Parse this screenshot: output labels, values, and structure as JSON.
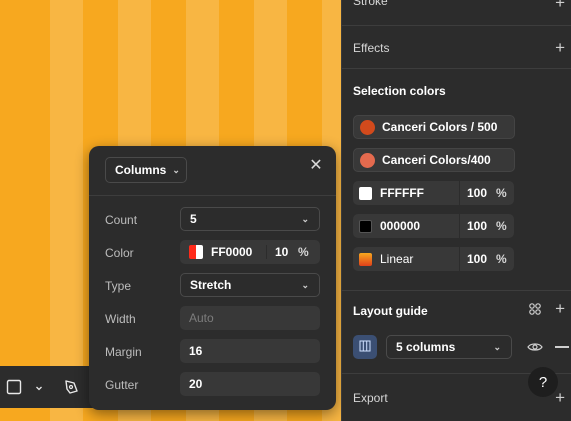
{
  "popup": {
    "header_select": "Columns",
    "rows": {
      "count_label": "Count",
      "count_value": "5",
      "color_label": "Color",
      "color_hex": "FF0000",
      "color_opacity": "10",
      "color_pct": "%",
      "type_label": "Type",
      "type_value": "Stretch",
      "width_label": "Width",
      "width_placeholder": "Auto",
      "margin_label": "Margin",
      "margin_value": "16",
      "gutter_label": "Gutter",
      "gutter_value": "20"
    }
  },
  "panel": {
    "stroke_title": "Stroke",
    "effects_title": "Effects",
    "selection_colors_title": "Selection colors",
    "styles": [
      {
        "label": "Canceri Colors / 500",
        "color": "#d24a1c"
      },
      {
        "label": "Canceri Colors/400",
        "color": "#e46a4e"
      }
    ],
    "colors": [
      {
        "hex": "FFFFFF",
        "opacity": "100",
        "pct": "%",
        "color": "#ffffff"
      },
      {
        "hex": "000000",
        "opacity": "100",
        "pct": "%",
        "color": "#000000"
      },
      {
        "hex": "Linear",
        "opacity": "100",
        "pct": "%",
        "color": "linear"
      }
    ],
    "layout_guide_title": "Layout guide",
    "layout_guide_select": "5 columns",
    "export_title": "Export",
    "help_label": "?"
  },
  "colors": {
    "canvas": "#f7a81f",
    "accent_blue": "#3b4f73",
    "panel_bg": "#2c2c2c"
  }
}
